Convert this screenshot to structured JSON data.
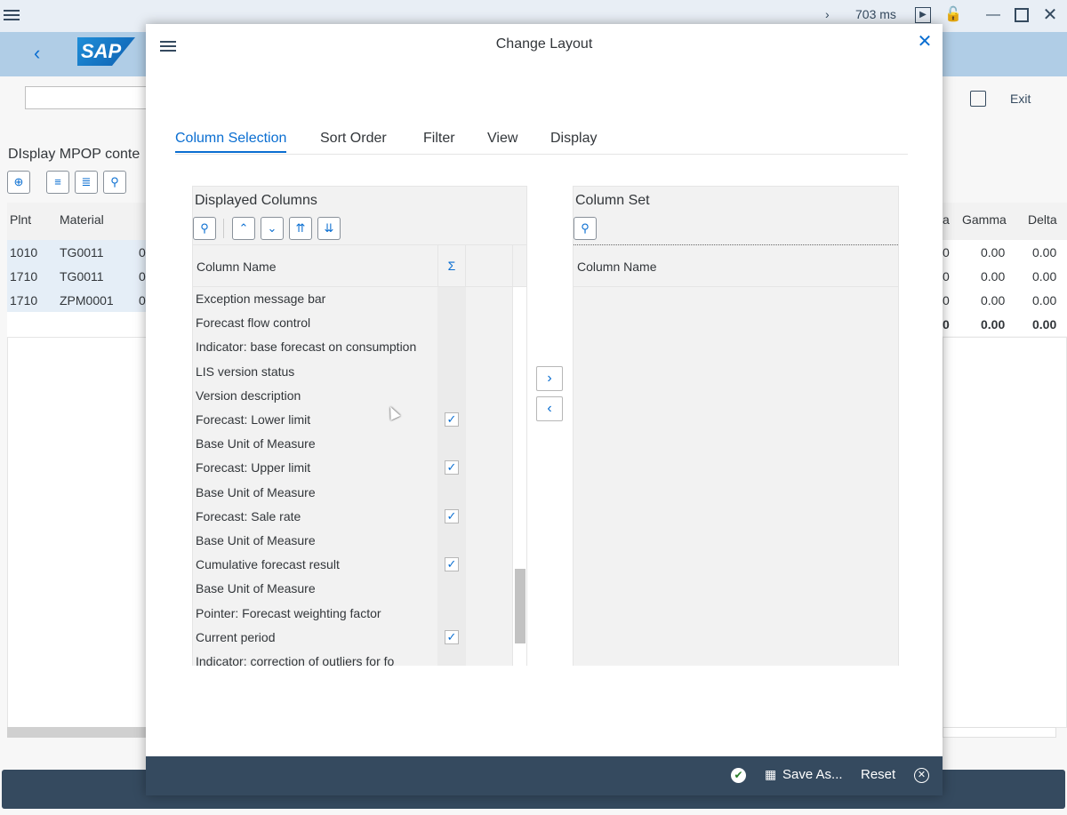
{
  "titlebar": {
    "timing": "703 ms"
  },
  "toolbar": {
    "exit_label": "Exit"
  },
  "background": {
    "title": "DIsplay MPOP conte",
    "col_plant": "Plnt",
    "col_material": "Material",
    "rows": [
      {
        "plant": "1010",
        "material": "TG0011",
        "extra": "0"
      },
      {
        "plant": "1710",
        "material": "TG0011",
        "extra": "0"
      },
      {
        "plant": "1710",
        "material": "ZPM0001",
        "extra": "0"
      }
    ],
    "right_cols": {
      "a": "a",
      "gamma": "Gamma",
      "delta": "Delta"
    },
    "right_rows": [
      {
        "a": "0",
        "gamma": "0.00",
        "delta": "0.00"
      },
      {
        "a": "0",
        "gamma": "0.00",
        "delta": "0.00"
      },
      {
        "a": "0",
        "gamma": "0.00",
        "delta": "0.00"
      }
    ],
    "right_total": {
      "a": "0",
      "gamma": "0.00",
      "delta": "0.00"
    }
  },
  "dialog": {
    "title": "Change Layout",
    "tabs": [
      "Column Selection",
      "Sort Order",
      "Filter",
      "View",
      "Display"
    ],
    "left_panel": {
      "title": "Displayed Columns",
      "col_header": "Column Name",
      "sum_header": "Σ",
      "rows": [
        {
          "name": "Exception message bar",
          "checked": false
        },
        {
          "name": "Forecast flow control",
          "checked": false
        },
        {
          "name": "Indicator: base forecast on consumption",
          "checked": false
        },
        {
          "name": "LIS version status",
          "checked": false
        },
        {
          "name": "Version description",
          "checked": false
        },
        {
          "name": "Forecast: Lower limit",
          "checked": true
        },
        {
          "name": "Base Unit of Measure",
          "checked": false
        },
        {
          "name": "Forecast: Upper limit",
          "checked": true
        },
        {
          "name": "Base Unit of Measure",
          "checked": false
        },
        {
          "name": "Forecast: Sale rate",
          "checked": true
        },
        {
          "name": "Base Unit of Measure",
          "checked": false
        },
        {
          "name": "Cumulative forecast result",
          "checked": true
        },
        {
          "name": "Base Unit of Measure",
          "checked": false
        },
        {
          "name": "Pointer: Forecast weighting factor",
          "checked": false
        },
        {
          "name": "Current period",
          "checked": true
        },
        {
          "name": "Indicator: correction of outliers for fo",
          "checked": false
        }
      ]
    },
    "right_panel": {
      "title": "Column Set",
      "col_header": "Column Name"
    },
    "footer": {
      "save_as": "Save As...",
      "reset": "Reset"
    }
  }
}
